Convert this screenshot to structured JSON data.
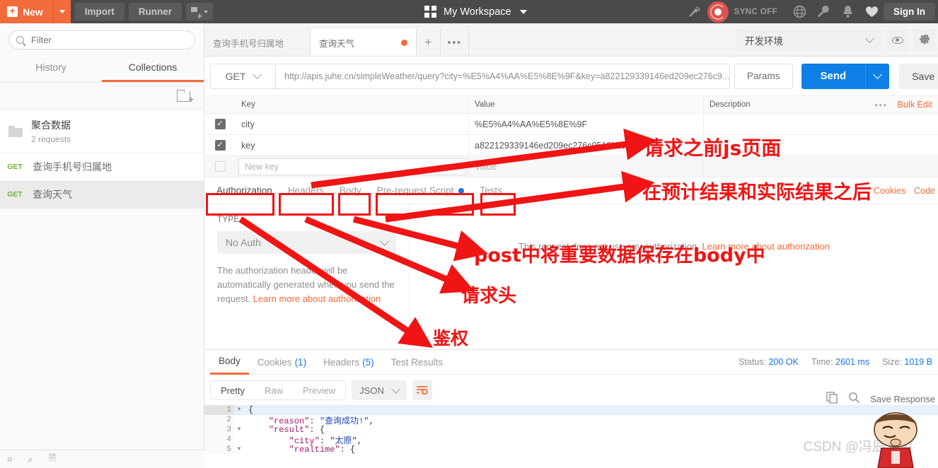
{
  "topbar": {
    "new_label": "New",
    "import_label": "Import",
    "runner_label": "Runner",
    "workspace_label": "My Workspace",
    "sync_label": "SYNC OFF",
    "signin_label": "Sign In",
    "icons": {
      "new_plus": "+",
      "new_caret": "caret-down-icon",
      "capture": "capture-requests-icon",
      "grid": "workspace-grid-icon",
      "antenna": "broadcast-icon",
      "sync": "sync-status-icon",
      "globe": "globe-icon",
      "wrench": "wrench-icon",
      "bell": "bell-icon",
      "heart": "heart-icon"
    }
  },
  "sidebar": {
    "filter_placeholder": "Filter",
    "filter_value": "",
    "tabs": [
      {
        "label": "History",
        "active": false
      },
      {
        "label": "Collections",
        "active": true
      }
    ],
    "new_folder_icon": "new-folder-icon",
    "collection": {
      "name": "聚合数据",
      "requests": "2 requests"
    },
    "requests": [
      {
        "method": "GET",
        "name": "查询手机号归属地",
        "selected": false
      },
      {
        "method": "GET",
        "name": "查询天气",
        "selected": true
      }
    ],
    "statusbar_icons": [
      "keyboard-shortcuts-icon",
      "find-icon",
      "console-icon"
    ]
  },
  "main": {
    "request_tabs": [
      {
        "label": "查询手机号归属地",
        "active": false,
        "unsaved": false
      },
      {
        "label": "查询天气",
        "active": true,
        "unsaved": true
      }
    ],
    "new_tab_icon": "+",
    "tab_menu_icon": "•••",
    "environment": {
      "selected": "开发环境",
      "eye_icon": "eye-icon",
      "settings_icon": "gear-icon"
    },
    "url_bar": {
      "method": "GET",
      "url": "http://apis.juhe.cn/simpleWeather/query?city=%E5%A4%AA%E5%8E%9F&key=a822129339146ed209ec276c9...",
      "params_label": "Params",
      "send_label": "Send",
      "save_label": "Save"
    },
    "params_table": {
      "headers": [
        "Key",
        "Value",
        "Description"
      ],
      "bulk_edit_label": "Bulk Edit",
      "rows": [
        {
          "checked": true,
          "key": "city",
          "value": "%E5%A4%AA%E5%8E%9F",
          "description": ""
        },
        {
          "checked": true,
          "key": "key",
          "value": "a822129339146ed209ec276c9513b292",
          "description": ""
        }
      ],
      "new_row": {
        "key_placeholder": "New key",
        "value_placeholder": "Value",
        "description_placeholder": ""
      }
    },
    "request_tabs_row": [
      {
        "label": "Authorization",
        "active": true,
        "dot": false
      },
      {
        "label": "Headers",
        "active": false,
        "dot": false
      },
      {
        "label": "Body",
        "active": false,
        "dot": false
      },
      {
        "label": "Pre-request Script",
        "active": false,
        "dot": true
      },
      {
        "label": "Tests",
        "active": false,
        "dot": false
      }
    ],
    "request_tabs_right": [
      "Cookies",
      "Code"
    ],
    "auth": {
      "type_label": "TYPE",
      "type_value": "No Auth",
      "description_text": "The authorization header will be automatically generated when you send the request. ",
      "description_link": "Learn more about authorization",
      "right_text": "This request does not use any authorization. ",
      "right_link": "Learn more about authorization"
    }
  },
  "response": {
    "tabs": [
      {
        "label": "Body",
        "count": "",
        "active": true
      },
      {
        "label": "Cookies",
        "count": "(1)",
        "active": false
      },
      {
        "label": "Headers",
        "count": "(5)",
        "active": false
      },
      {
        "label": "Test Results",
        "count": "",
        "active": false
      }
    ],
    "status_label": "Status:",
    "status_value": "200 OK",
    "time_label": "Time:",
    "time_value": "2601 ms",
    "size_label": "Size:",
    "size_value": "1019 B",
    "view_modes": [
      {
        "label": "Pretty",
        "active": true
      },
      {
        "label": "Raw",
        "active": false
      },
      {
        "label": "Preview",
        "active": false
      }
    ],
    "format": "JSON",
    "wrap_icon": "word-wrap-icon",
    "copy_icon": "copy-icon",
    "search_icon": "search-icon",
    "save_response_label": "Save Response",
    "body_lines": [
      {
        "num": "1",
        "fold": true,
        "text": "{"
      },
      {
        "num": "2",
        "fold": false,
        "text": "    \"reason\": \"查询成功!\","
      },
      {
        "num": "3",
        "fold": true,
        "text": "    \"result\": {"
      },
      {
        "num": "4",
        "fold": false,
        "text": "        \"city\": \"太原\","
      },
      {
        "num": "5",
        "fold": true,
        "text": "        \"realtime\": {"
      }
    ]
  },
  "annotations": {
    "color": "#f01414",
    "notes": [
      {
        "id": "note-js-before-request",
        "text": "请求之前js页面"
      },
      {
        "id": "note-after-results",
        "text": "在预计结果和实际结果之后"
      },
      {
        "id": "note-post-body",
        "text": "post中将重要数据保存在body中"
      },
      {
        "id": "note-request-header",
        "text": "请求头"
      },
      {
        "id": "note-auth",
        "text": "鉴权"
      }
    ]
  },
  "watermark": {
    "text": "CSDN @冯辰云中"
  }
}
